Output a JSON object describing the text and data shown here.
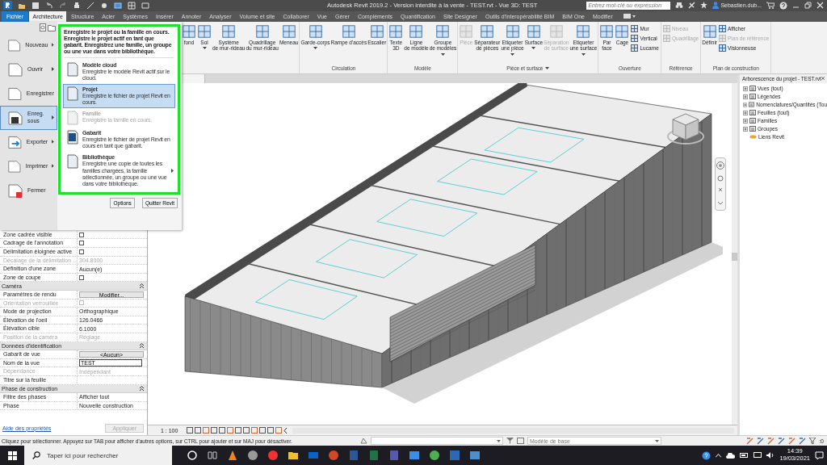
{
  "window": {
    "title": "Autodesk Revit 2019.2 - Version interdite à la vente - TEST.rvt - Vue 3D: TEST"
  },
  "search": {
    "placeholder": "Entrez mot-clé ou expression"
  },
  "user": {
    "name": "Sebastien.dub..."
  },
  "ribbon_tabs": [
    {
      "label": "Fichier",
      "kind": "file",
      "selected": false
    },
    {
      "label": "Architecture",
      "kind": "tab",
      "selected": true
    },
    {
      "label": "Structure",
      "kind": "tab",
      "selected": false
    },
    {
      "label": "Acier",
      "kind": "tab",
      "selected": false
    },
    {
      "label": "Systèmes",
      "kind": "tab",
      "selected": false
    },
    {
      "label": "Insérer",
      "kind": "tab",
      "selected": false
    },
    {
      "label": "Annoter",
      "kind": "tab",
      "selected": false
    },
    {
      "label": "Analyser",
      "kind": "tab",
      "selected": false
    },
    {
      "label": "Volume et site",
      "kind": "tab",
      "selected": false
    },
    {
      "label": "Collaborer",
      "kind": "tab",
      "selected": false
    },
    {
      "label": "Vue",
      "kind": "tab",
      "selected": false
    },
    {
      "label": "Gérer",
      "kind": "tab",
      "selected": false
    },
    {
      "label": "Compléments",
      "kind": "tab",
      "selected": false
    },
    {
      "label": "Quantification",
      "kind": "tab",
      "selected": false
    },
    {
      "label": "Site Designer",
      "kind": "tab",
      "selected": false
    },
    {
      "label": "Outils d'interopérabilité BIM",
      "kind": "tab",
      "selected": false
    },
    {
      "label": "BIM One",
      "kind": "tab",
      "selected": false
    },
    {
      "label": "Modifier",
      "kind": "tab",
      "selected": false
    }
  ],
  "ribbon_panels": [
    {
      "tools": [
        {
          "kind": "large",
          "label": "fond",
          "disabled": false,
          "dropdown": false
        },
        {
          "kind": "large",
          "label": "Sol",
          "disabled": false,
          "dropdown": true
        },
        {
          "kind": "large",
          "label": "Système\nde mur-rideau",
          "disabled": false,
          "dropdown": false
        },
        {
          "kind": "large",
          "label": "Quadrillage\ndu mur-rideau",
          "disabled": false,
          "dropdown": false
        },
        {
          "kind": "large",
          "label": "Meneau",
          "disabled": false,
          "dropdown": false
        }
      ]
    },
    {
      "title": "Circulation",
      "tools": [
        {
          "kind": "large",
          "label": "Garde-corps",
          "disabled": false,
          "dropdown": true
        },
        {
          "kind": "large",
          "label": "Rampe d'accès",
          "disabled": false,
          "dropdown": false
        },
        {
          "kind": "large",
          "label": "Escalier",
          "disabled": false,
          "dropdown": false
        }
      ]
    },
    {
      "title": "Modèle",
      "tools": [
        {
          "kind": "large",
          "label": "Texte\n3D",
          "disabled": false,
          "dropdown": false
        },
        {
          "kind": "large",
          "label": "Ligne\nde modèle",
          "disabled": false,
          "dropdown": false
        },
        {
          "kind": "large",
          "label": "Groupe\nde modèles",
          "disabled": false,
          "dropdown": true
        }
      ]
    },
    {
      "title": "Pièce et surface",
      "title_dropdown": true,
      "tools": [
        {
          "kind": "large",
          "label": "Pièce",
          "disabled": true,
          "dropdown": false
        },
        {
          "kind": "large",
          "label": "Séparateur\nde pièces",
          "disabled": false,
          "dropdown": false
        },
        {
          "kind": "large",
          "label": "Etiqueter\nune pièce",
          "disabled": false,
          "dropdown": true
        },
        {
          "kind": "large",
          "label": "Surface",
          "disabled": false,
          "dropdown": true
        },
        {
          "kind": "large",
          "label": "Séparation\nde surface",
          "disabled": true,
          "dropdown": false
        },
        {
          "kind": "large",
          "label": "Etiqueter\nune surface",
          "disabled": false,
          "dropdown": true
        }
      ]
    },
    {
      "title": "Ouverture",
      "tools": [
        {
          "kind": "large",
          "label": "Par\nface",
          "disabled": false,
          "dropdown": false
        },
        {
          "kind": "large",
          "label": "Cage",
          "disabled": false,
          "dropdown": false
        },
        {
          "kind": "stack",
          "items": [
            {
              "label": "Mur",
              "disabled": false
            },
            {
              "label": "Vertical",
              "disabled": false
            },
            {
              "label": "Lucarne",
              "disabled": false
            }
          ]
        }
      ]
    },
    {
      "title": "Référence",
      "tools": [
        {
          "kind": "stack",
          "items": [
            {
              "label": "Niveau",
              "disabled": true
            },
            {
              "label": "Quadrillage",
              "disabled": true
            }
          ]
        }
      ]
    },
    {
      "title": "Plan de construction",
      "tools": [
        {
          "kind": "large",
          "label": "Définir",
          "disabled": false,
          "dropdown": false
        },
        {
          "kind": "stack",
          "items": [
            {
              "label": "Afficher",
              "disabled": false
            },
            {
              "label": "Plan de référence",
              "disabled": true
            },
            {
              "label": "Visionneuse",
              "disabled": false
            }
          ]
        }
      ]
    }
  ],
  "file_menu": {
    "items": [
      {
        "label": "Nouveau",
        "submenu": true,
        "selected": false
      },
      {
        "label": "Ouvrir",
        "submenu": true,
        "selected": false
      },
      {
        "label": "Enregistrer",
        "submenu": false,
        "selected": false
      },
      {
        "label": "Enreg.\nsous",
        "submenu": true,
        "selected": true
      },
      {
        "label": "Exporter",
        "submenu": true,
        "selected": false
      },
      {
        "label": "Imprimer",
        "submenu": true,
        "selected": false
      },
      {
        "label": "Fermer",
        "submenu": false,
        "selected": false
      }
    ],
    "description": "Enregistre le projet ou la famille en cours. Enregistre le projet actif en tant que gabarit. Enregistrez une famille, un groupe ou une vue dans votre bibliothèque.",
    "options": [
      {
        "title": "Modèle cloud",
        "description": "Enregistre le modèle Revit actif sur le cloud.",
        "selected": false,
        "disabled": false,
        "submenu": false
      },
      {
        "title": "Projet",
        "description": "Enregistre le fichier de projet Revit en cours.",
        "selected": true,
        "disabled": false,
        "submenu": false
      },
      {
        "title": "Famille",
        "description": "Enregistre la famille en cours.",
        "selected": false,
        "disabled": true,
        "submenu": false
      },
      {
        "title": "Gabarit",
        "description": "Enregistre le fichier de projet Revit en cours en tant que gabarit.",
        "selected": false,
        "disabled": false,
        "submenu": false
      },
      {
        "title": "Bibliothèque",
        "description": "Enregistre une copie de toutes les familles chargées, la famille sélectionnée, un groupe ou une vue dans votre bibliothèque.",
        "selected": false,
        "disabled": false,
        "submenu": true
      }
    ],
    "buttons": [
      "Options",
      "Quitter Revit"
    ]
  },
  "properties": {
    "rows": [
      {
        "kind": "checkbox",
        "label": "Zone cadrée visible",
        "checked": false,
        "disabled": false
      },
      {
        "kind": "checkbox",
        "label": "Cadrage de l'annotation",
        "checked": false,
        "disabled": false
      },
      {
        "kind": "checkbox",
        "label": "Délimitation éloignée active",
        "checked": false,
        "disabled": false
      },
      {
        "kind": "text",
        "label": "Décalage de la délimitation ...",
        "value": "304.8000",
        "disabled": true
      },
      {
        "kind": "text",
        "label": "Définition d'une zone",
        "value": "Aucun(e)",
        "disabled": false
      },
      {
        "kind": "checkbox",
        "label": "Zone de coupe",
        "checked": false,
        "disabled": false
      },
      {
        "kind": "header",
        "label": "Caméra"
      },
      {
        "kind": "button",
        "label": "Paramètres de rendu",
        "value": "Modifier...",
        "disabled": false
      },
      {
        "kind": "checkbox",
        "label": "Orientation verrouillée",
        "checked": false,
        "disabled": true
      },
      {
        "kind": "text",
        "label": "Mode de projection",
        "value": "Orthographique",
        "disabled": false
      },
      {
        "kind": "text",
        "label": "Élévation de l'oeil",
        "value": "126.0466",
        "disabled": false
      },
      {
        "kind": "text",
        "label": "Élévation cible",
        "value": "6.1000",
        "disabled": false
      },
      {
        "kind": "text",
        "label": "Position de la caméra",
        "value": "Réglage",
        "disabled": true
      },
      {
        "kind": "header",
        "label": "Données d'identification"
      },
      {
        "kind": "button",
        "label": "Gabarit de vue",
        "value": "<Aucun>",
        "disabled": false
      },
      {
        "kind": "input",
        "label": "Nom de la vue",
        "value": "TEST",
        "disabled": false
      },
      {
        "kind": "text",
        "label": "Dépendance",
        "value": "Indépendant",
        "disabled": true
      },
      {
        "kind": "text",
        "label": "Titre sur la feuille",
        "disabled": false
      },
      {
        "kind": "header",
        "label": "Phase de construction"
      },
      {
        "kind": "text",
        "label": "Filtre des phases",
        "value": "Afficher tout",
        "disabled": false
      },
      {
        "kind": "text",
        "label": "Phase",
        "value": "Nouvelle construction",
        "disabled": false
      }
    ],
    "help_link": "Aide des propriétés",
    "apply_button": {
      "label": "Appliquer",
      "disabled": true
    }
  },
  "view_bar": {
    "scale": "1 : 100"
  },
  "project_browser": {
    "title": "Arborescence du projet - TEST.rvt",
    "items": [
      {
        "label": "Vues (tout)",
        "expandable": true
      },
      {
        "label": "Légendes",
        "expandable": true
      },
      {
        "label": "Nomenclatures/Quantités (Tou",
        "expandable": true
      },
      {
        "label": "Feuilles (tout)",
        "expandable": true
      },
      {
        "label": "Familles",
        "expandable": true
      },
      {
        "label": "Groupes",
        "expandable": true
      },
      {
        "label": "Liens Revit",
        "expandable": false
      }
    ]
  },
  "status_bar": {
    "text": "Cliquez pour sélectionner. Appuyez sur TAB pour afficher d'autres options, sur CTRL pour ajouter et sur MAJ pour désactiver.",
    "workset": "Modèle de base",
    "filter_count": ":0"
  },
  "taskbar": {
    "search_placeholder": "Taper ici pour rechercher",
    "time": "14:39",
    "date": "19/03/2021"
  }
}
